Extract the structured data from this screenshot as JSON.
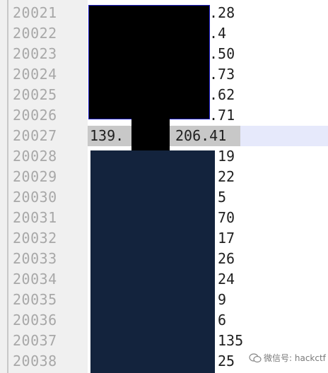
{
  "editor": {
    "lines": [
      {
        "num": "20021",
        "text": ".28"
      },
      {
        "num": "20022",
        "text": ".4"
      },
      {
        "num": "20023",
        "text": ".50"
      },
      {
        "num": "20024",
        "text": ".73"
      },
      {
        "num": "20025",
        "text": ".62"
      },
      {
        "num": "20026",
        "text": ".71"
      },
      {
        "num": "20027",
        "left": "139.",
        "right": "206.41"
      },
      {
        "num": "20028",
        "text": "19"
      },
      {
        "num": "20029",
        "text": "22"
      },
      {
        "num": "20030",
        "text": "5"
      },
      {
        "num": "20031",
        "text": "70"
      },
      {
        "num": "20032",
        "text": "17"
      },
      {
        "num": "20033",
        "text": "26"
      },
      {
        "num": "20034",
        "text": "24"
      },
      {
        "num": "20035",
        "text": "9"
      },
      {
        "num": "20036",
        "text": "6"
      },
      {
        "num": "20037",
        "text": "135"
      },
      {
        "num": "20038",
        "text": "25"
      }
    ]
  },
  "watermark": {
    "icon": "wechat-icon",
    "text": "微信号: hackctf"
  }
}
